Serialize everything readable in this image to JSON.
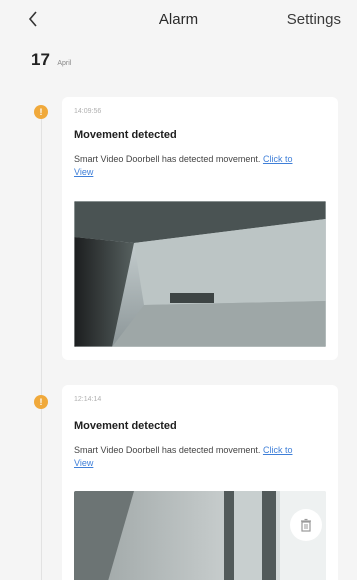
{
  "header": {
    "title": "Alarm",
    "settings_label": "Settings",
    "back_icon": "chevron-left-icon"
  },
  "date": {
    "day": "17",
    "month": "April"
  },
  "events": [
    {
      "time": "14:09:56",
      "title": "Movement detected",
      "description": "Smart Video Doorbell has detected movement.",
      "link_label": "Click to View",
      "status_color": "#f0a93b"
    },
    {
      "time": "12:14:14",
      "title": "Movement detected",
      "description": "Smart Video Doorbell has detected movement.",
      "link_label": "Click to View",
      "status_color": "#f0a93b",
      "action_icon": "trash-icon"
    }
  ]
}
